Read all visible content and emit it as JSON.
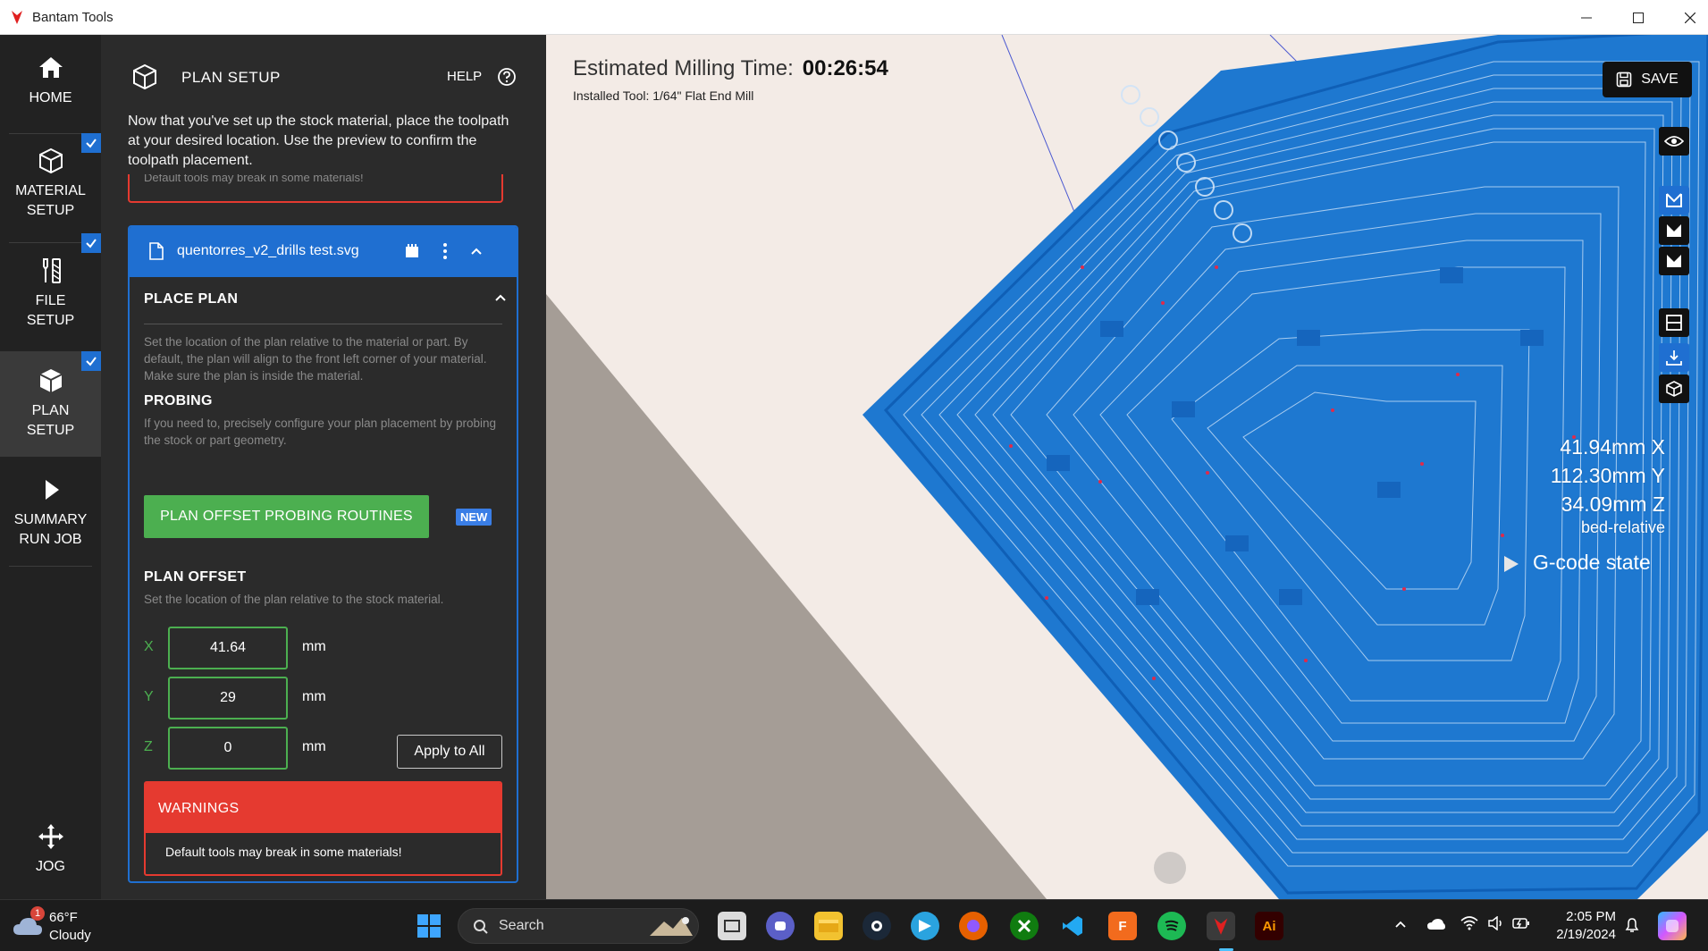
{
  "window": {
    "title": "Bantam Tools"
  },
  "nav": {
    "items": [
      {
        "label_line1": "HOME",
        "label_line2": ""
      },
      {
        "label_line1": "MATERIAL",
        "label_line2": "SETUP"
      },
      {
        "label_line1": "FILE",
        "label_line2": "SETUP"
      },
      {
        "label_line1": "PLAN",
        "label_line2": "SETUP"
      },
      {
        "label_line1": "SUMMARY",
        "label_line2": "RUN JOB"
      }
    ],
    "jog_label": "JOG"
  },
  "panel": {
    "title": "PLAN SETUP",
    "help_label": "HELP",
    "intro": "Now that you've set up the stock material, place the toolpath at your desired location. Use the preview to confirm the toolpath placement.",
    "prev_warning_partial": "Default tools may break in some materials!",
    "file": {
      "name": "quentorres_v2_drills test.svg",
      "place_plan_title": "PLACE PLAN",
      "place_plan_desc": "Set the location of the plan relative to the material or part. By default, the plan will align to the front left corner of your material. Make sure the plan is inside the material.",
      "probing_title": "PROBING",
      "probing_desc": "If you need to, precisely configure your plan placement by probing the stock or part geometry.",
      "probing_button": "PLAN OFFSET PROBING ROUTINES",
      "new_badge": "NEW",
      "offset_title": "PLAN OFFSET",
      "offset_desc": "Set the location of the plan relative to the stock material.",
      "offset": [
        {
          "axis": "X",
          "value": "41.64",
          "unit": "mm"
        },
        {
          "axis": "Y",
          "value": "29",
          "unit": "mm"
        },
        {
          "axis": "Z",
          "value": "0",
          "unit": "mm"
        }
      ],
      "apply_label": "Apply to All",
      "warnings_title": "WARNINGS",
      "warning_text": "Default tools may break in some materials!"
    }
  },
  "viewport": {
    "est_label": "Estimated Milling Time:",
    "est_value": "00:26:54",
    "tool_label": "Installed Tool: 1/64\" Flat End Mill",
    "save_label": "SAVE",
    "coords": {
      "x": "41.94mm X",
      "y": "112.30mm Y",
      "z": "34.09mm Z",
      "ref": "bed-relative"
    },
    "gcode_label": "G-code state"
  },
  "taskbar": {
    "weather_badge": "1",
    "temp": "66°F",
    "condition": "Cloudy",
    "search_label": "Search",
    "time": "2:05 PM",
    "date": "2/19/2024"
  },
  "colors": {
    "accent_blue": "#1f6fd1",
    "probe_green": "#4caf50",
    "warning_red": "#e53a30",
    "pcb_blue": "#1e78d0"
  }
}
